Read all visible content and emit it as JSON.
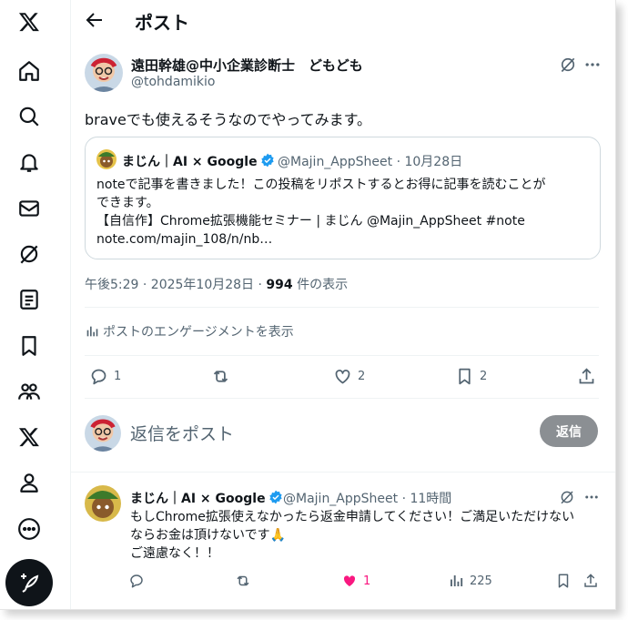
{
  "header": {
    "title": "ポスト"
  },
  "sidebar": {
    "items": [
      {
        "name": "x-logo-icon"
      },
      {
        "name": "home-icon"
      },
      {
        "name": "search-icon"
      },
      {
        "name": "bell-icon"
      },
      {
        "name": "mail-icon"
      },
      {
        "name": "grok-icon"
      },
      {
        "name": "lists-icon"
      },
      {
        "name": "bookmark-icon"
      },
      {
        "name": "communities-icon"
      },
      {
        "name": "premium-x-icon"
      },
      {
        "name": "profile-icon"
      },
      {
        "name": "more-icon"
      }
    ],
    "post_button_icon": "feather-plus-icon"
  },
  "main_post": {
    "display_name": "遠田幹雄@中小企業診断士　どもども",
    "handle": "@tohdamikio",
    "text": "braveでも使えるそうなのでやってみます。",
    "quote": {
      "display_name": "まじん｜AI × Google",
      "handle_time": "@Majin_AppSheet · 10月28日",
      "lines": [
        "noteで記事を書きました！この投稿をリポストするとお得に記事を読むことが",
        "できます。",
        "【自信作】Chrome拡張機能セミナー | まじん @Majin_AppSheet #note",
        "note.com/majin_108/n/nb…"
      ]
    },
    "meta_time": "午後5:29 · 2025年10月28日 · ",
    "meta_views": "994",
    "meta_views_label": " 件の表示",
    "engagement_link": "ポストのエンゲージメントを表示",
    "actions": {
      "replies": "1",
      "reposts": "",
      "likes": "2",
      "bookmarks": "2"
    }
  },
  "reply_composer": {
    "placeholder": "返信をポスト",
    "button": "返信"
  },
  "reply": {
    "display_name": "まじん｜AI × Google",
    "handle_time": "@Majin_AppSheet · 11時間",
    "lines": [
      "もしChrome拡張使えなかったら返金申請してください！ご満足いただけない",
      "ならお金は頂けないです🙏",
      "ご遠慮なく！！"
    ],
    "actions": {
      "replies": "",
      "reposts": "",
      "likes": "1",
      "views": "225"
    }
  },
  "colors": {
    "verified": "#1d9bf0",
    "like_active": "#f91880",
    "text": "#0f1419",
    "muted": "#536471"
  }
}
